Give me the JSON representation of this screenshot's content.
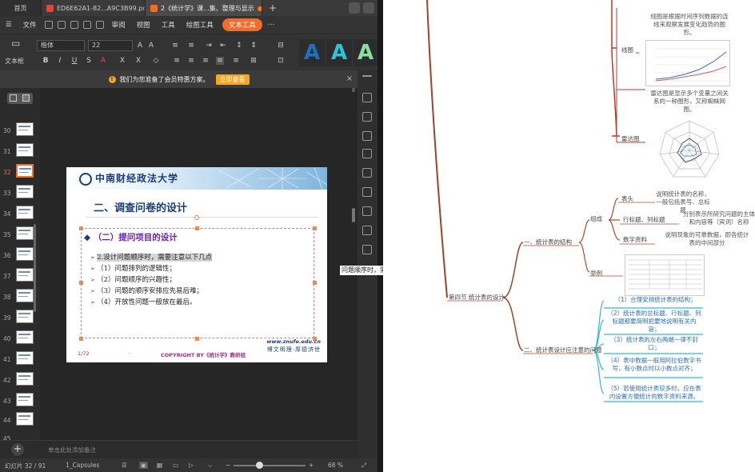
{
  "tabs": {
    "home": "首页",
    "pdf": "ED6E62A1-82...A9C3B99.pdf",
    "active": "2《统计学》课...集、整理与显示",
    "new_tab": "+"
  },
  "menu": {
    "file": "文件",
    "items": [
      "审阅",
      "视图",
      "工具",
      "绘图工具",
      "文本工具"
    ]
  },
  "ribbon": {
    "font_name": "楷体",
    "font_size": "22",
    "text_box": "文本框"
  },
  "notice": {
    "text": "我们为您准备了会员特惠方案。",
    "button": "立即查看",
    "close": "×"
  },
  "thumbnails": {
    "selected": "32",
    "pages": [
      "30",
      "31",
      "32",
      "33",
      "34",
      "35",
      "36",
      "37",
      "38",
      "39",
      "40",
      "41",
      "42",
      "43",
      "44",
      "45"
    ]
  },
  "slide": {
    "university": "中南财经政法大学",
    "title": "二、调查问卷的设计",
    "subtitle": "（二）提问项目的设计",
    "bullets": {
      "b0": "2.设计问题顺序时，需要注意以下几点",
      "b1": "（1）问题排列的逻辑性；",
      "b2": "（2）问题顺序的兴趣性；",
      "b3": "（3）问题的顺序安排应先易后难；",
      "b4": "（4）开放性问题一般放在最后。"
    },
    "url": "www.znufe.edu.cn",
    "motto": "博文明理·厚德济世",
    "page": "1/72",
    "dot": "·",
    "copyright": "COPYRIGHT BY《统计学》教研组"
  },
  "notes": {
    "placeholder": "单击此处添加备注",
    "add": "+"
  },
  "status": {
    "slide_info": "幻灯片 32 / 91",
    "theme": "1_Capsules",
    "zoom": "68 %"
  },
  "drag_tip": "问题顺序时，需要注意以下几点",
  "mindmap": {
    "line_desc": "线图是根据时间序列数据的连线来观察发展变化趋势的图形。",
    "line_label": "线图",
    "radar_desc": "雷达图是显示多个变量之间关系的一种图形，又称蜘蛛网图。",
    "radar_label": "雷达图",
    "header": "表头",
    "header_desc": "说明统计表的名称，一般包括表号、总标题",
    "row_col": "行标题、列标题",
    "row_col_desc": "分别表示所研究问题的主体和内容等（宾词）名称",
    "data": "数字资料",
    "data_desc": "说明现象的可靠数据，即各统计表的中间部分",
    "composition": "组成",
    "example": "举例",
    "structure": "一、统计表的结构",
    "section": "第四节 统计表的设计",
    "design": "二、统计表设计应注意的问题",
    "n1": "（1）合理安排统计表的结构；",
    "n2": "（2）统计表的总标题、行标题、列标题都要简明扼要地说明有关内容；",
    "n3": "（3）统计表的左右两端一律不封口；",
    "n4": "（4）表中数据一般用阿拉伯数字书写，有小数点时以小数点对齐；",
    "n5": "（5）若使用统计表较多时，应在表内设置方便统计的数字资料来源。"
  },
  "colors": {
    "accent": "#f06d2c",
    "branch": "#a0422a",
    "blue": "#2a6fb5",
    "cyan": "#35b6d6"
  }
}
